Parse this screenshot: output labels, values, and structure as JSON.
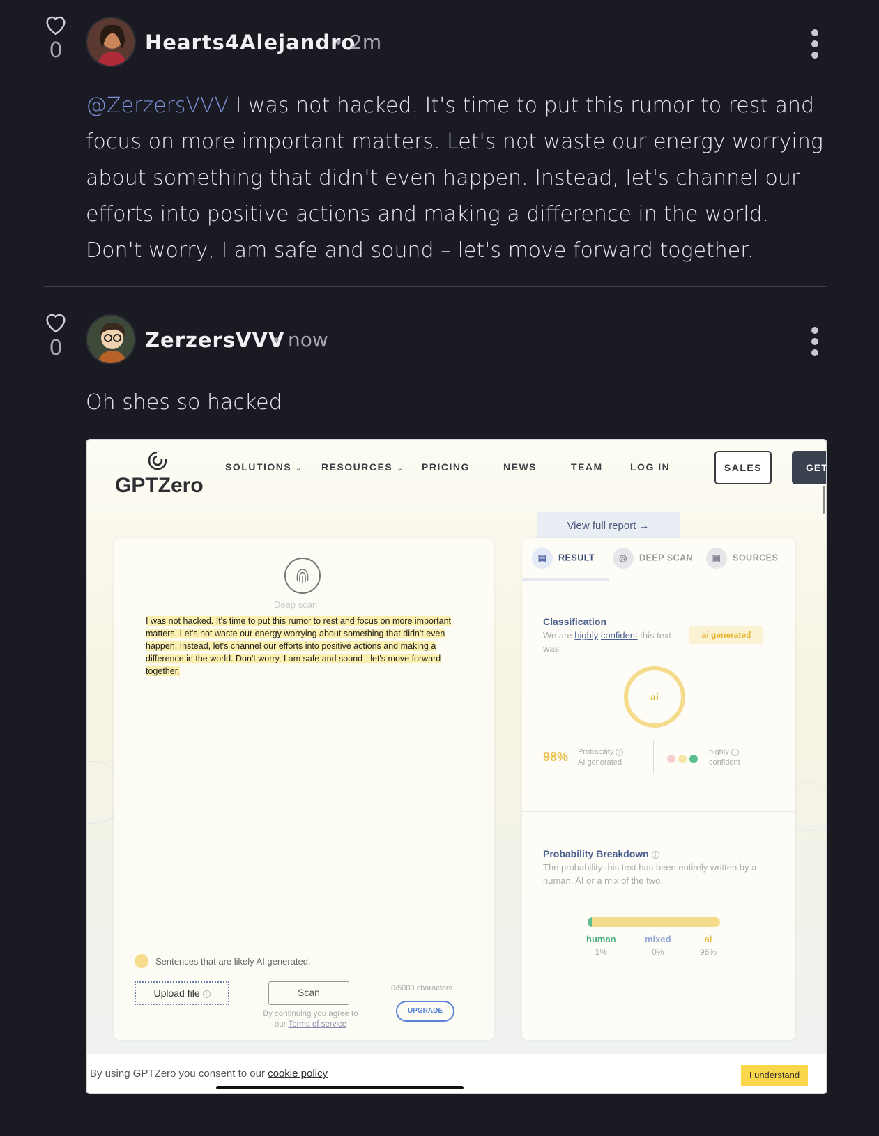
{
  "comments": [
    {
      "likes": "0",
      "author": "Hearts4Alejandro",
      "separator": "•",
      "time": "2m",
      "mention": "@ZerzersVVV",
      "text": " I was not hacked. It's time to put this rumor to rest and focus on more important matters. Let's not waste our energy worrying about something that didn't even happen. Instead, let's channel our efforts into positive actions and making a difference in the world. Don't worry, I am safe and sound – let's move forward together."
    },
    {
      "likes": "0",
      "author": "ZerzersVVV",
      "separator": "•",
      "time": "now",
      "text": "Oh shes so hacked"
    }
  ],
  "screenshot": {
    "brand": "GPTZero",
    "nav": [
      "SOLUTIONS",
      "RESOURCES",
      "PRICING",
      "NEWS",
      "TEAM",
      "LOG IN"
    ],
    "sales": "SALES",
    "get": "GET",
    "view_report": "View full report →",
    "deep_scan_label": "Deep scan",
    "sample_text": "I was not hacked. It's time to put this rumor to rest and focus on more important matters. Let's not waste our energy worrying about something that didn't even happen. Instead, let's channel our efforts into positive actions and making a difference in the world. Don't worry, I am safe and sound - let's move forward together.",
    "legend": "Sentences that are likely AI generated.",
    "upload": "Upload file",
    "scan": "Scan",
    "agree_prefix": "By continuing you agree to our ",
    "agree_link": "Terms of service",
    "chars": "0/5000 characters",
    "upgrade": "UPGRADE",
    "tabs": [
      "RESULT",
      "DEEP SCAN",
      "SOURCES"
    ],
    "classification": {
      "title": "Classification",
      "sub_prefix": "We are ",
      "sub_link1": "highly",
      "sub_link2": "confident",
      "sub_suffix": " this text was",
      "badge": "ai generated",
      "ring": "ai",
      "pct": "98%",
      "pct_label_1": "Probability",
      "pct_label_2": "AI generated",
      "conf_label_1": "highly",
      "conf_label_2": "confident"
    },
    "breakdown": {
      "title": "Probability Breakdown",
      "sub": "The probability this text has been entirely written by a human, AI or a mix of the two.",
      "human_label": "human",
      "human_pct": "1%",
      "human_value": 0.01,
      "mixed_label": "mixed",
      "mixed_pct": "0%",
      "mixed_value": 0,
      "ai_label": "ai",
      "ai_pct": "98%",
      "ai_value": 0.98
    },
    "cookie_prefix": "By using GPTZero you consent to our ",
    "cookie_link": "cookie policy",
    "cookie_btn": "I understand"
  },
  "colors": {
    "background": "#191a22",
    "mention": "#7b8fd6",
    "ai_yellow": "#f5dc8c",
    "human_green": "#5dbf8e",
    "mixed_blue": "#8fa4d6"
  }
}
